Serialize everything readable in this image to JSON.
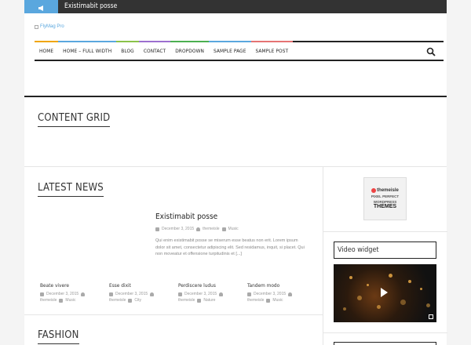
{
  "ticker": {
    "label_icon": "megaphone-icon",
    "text": "Existimabit posse"
  },
  "logo": {
    "alt": "FlyMag Pro"
  },
  "nav": {
    "items": [
      {
        "label": "HOME",
        "color": "#f0a500"
      },
      {
        "label": "HOME – FULL WIDTH",
        "color": "#5aa7de"
      },
      {
        "label": "BLOG",
        "color": "#8bc34a"
      },
      {
        "label": "CONTACT",
        "color": "#9c6fcf"
      },
      {
        "label": "DROPDOWN",
        "color": "#4caf50"
      },
      {
        "label": "SAMPLE PAGE",
        "color": "#5aa7de"
      },
      {
        "label": "SAMPLE POST",
        "color": "#e57373"
      }
    ]
  },
  "sections": {
    "content_grid": "CONTENT GRID",
    "latest_news": "LATEST NEWS",
    "fashion": "FASHION"
  },
  "featured": {
    "title": "Existimabit posse",
    "date": "December 3, 2015",
    "author": "themeisle",
    "category": "Music",
    "excerpt": "Qui enim existimabit posse se miserum esse beatus non erit. Lorem ipsum dolor sit amet, consectetur adipiscing elit. Sed residamus, inquit, si placet. Qui non moveatur et offensione turpitudinis et [...]"
  },
  "small_posts": [
    {
      "title": "Beate vivere",
      "date": "December 3, 2015",
      "author": "themeisle",
      "category": "Music"
    },
    {
      "title": "Esse dixit",
      "date": "December 3, 2015",
      "author": "themeisle",
      "category": "City"
    },
    {
      "title": "Perdiscere ludus",
      "date": "December 3, 2015",
      "author": "themeisle",
      "category": "Nature"
    },
    {
      "title": "Tandem modo",
      "date": "December 3, 2015",
      "author": "themeisle",
      "category": "Music"
    }
  ],
  "sidebar": {
    "ad": {
      "brand": "themeisle",
      "line1": "PIXEL PERFECT",
      "line2": "WORDPRESS",
      "line3": "THEMES"
    },
    "video_widget_title": "Video widget"
  }
}
